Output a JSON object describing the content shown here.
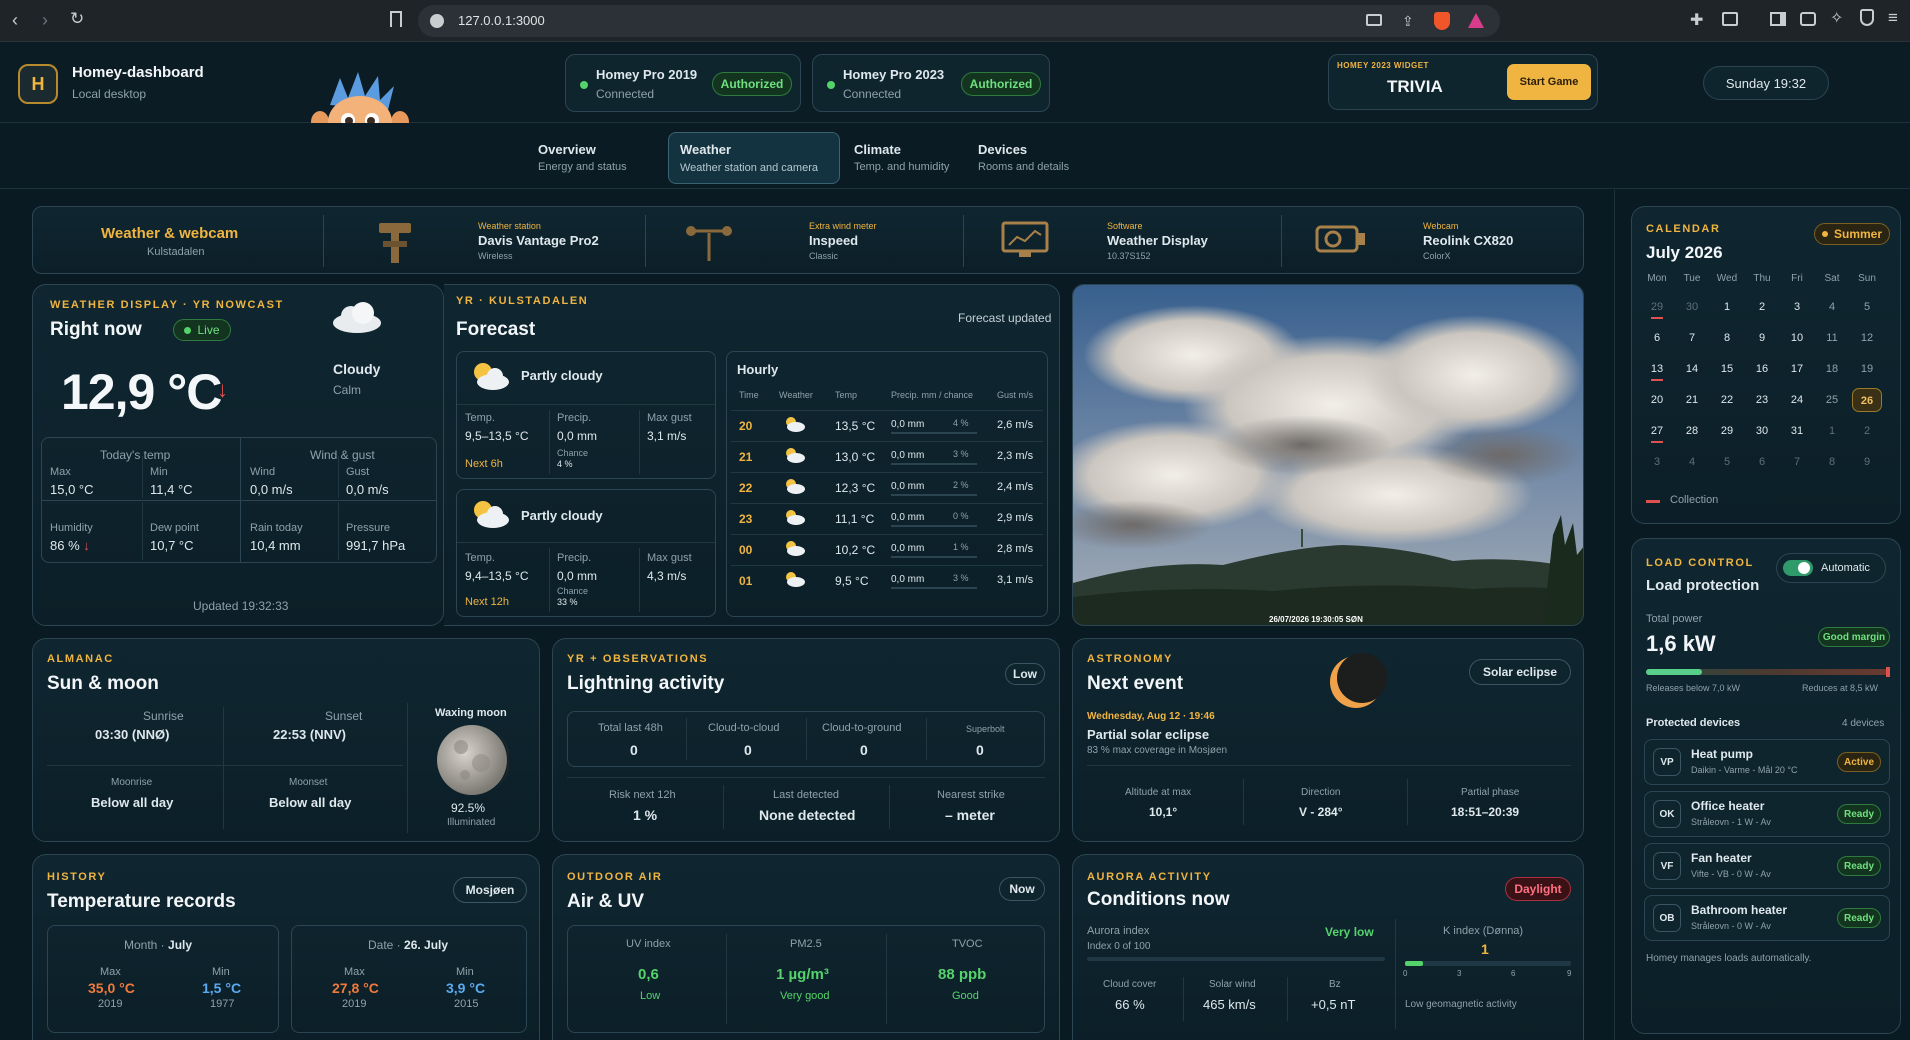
{
  "browser": {
    "url": "127.0.0.1:3000"
  },
  "header": {
    "logo_letter": "H",
    "app_title": "Homey-dashboard",
    "app_subtitle": "Local desktop",
    "devices": [
      {
        "name": "Homey Pro 2019",
        "status": "Connected",
        "badge": "Authorized"
      },
      {
        "name": "Homey Pro 2023",
        "status": "Connected",
        "badge": "Authorized"
      }
    ],
    "widget": {
      "tag": "HOMEY 2023 WIDGET",
      "title": "TRIVIA",
      "button": "Start Game"
    },
    "clock": "Sunday 19:32"
  },
  "tabs": [
    {
      "label": "Overview",
      "sub": "Energy and status"
    },
    {
      "label": "Weather",
      "sub": "Weather station and camera"
    },
    {
      "label": "Climate",
      "sub": "Temp. and humidity"
    },
    {
      "label": "Devices",
      "sub": "Rooms and details"
    }
  ],
  "equip": {
    "title": "Weather & webcam",
    "subtitle": "Kulstadalen",
    "items": [
      {
        "cat": "Weather station",
        "name": "Davis Vantage Pro2",
        "sub": "Wireless"
      },
      {
        "cat": "Extra wind meter",
        "name": "Inspeed",
        "sub": "Classic"
      },
      {
        "cat": "Software",
        "name": "Weather Display",
        "sub": "10.37S152"
      },
      {
        "cat": "Webcam",
        "name": "Reolink CX820",
        "sub": "ColorX"
      }
    ]
  },
  "now": {
    "label": "WEATHER DISPLAY · YR NOWCAST",
    "title": "Right now",
    "live": "Live",
    "temp": "12,9 °C",
    "trend": "↓",
    "condition": "Cloudy",
    "wind_desc": "Calm",
    "today_temp": "Today's temp",
    "wind_gust": "Wind & gust",
    "max_l": "Max",
    "max_v": "15,0 °C",
    "min_l": "Min",
    "min_v": "11,4 °C",
    "wind_l": "Wind",
    "wind_v": "0,0 m/s",
    "gust_l": "Gust",
    "gust_v": "0,0 m/s",
    "hum_l": "Humidity",
    "hum_v": "86 %",
    "dew_l": "Dew point",
    "dew_v": "10,7 °C",
    "rain_l": "Rain today",
    "rain_v": "10,4 mm",
    "pres_l": "Pressure",
    "pres_v": "991,7 hPa",
    "updated": "Updated 19:32:33"
  },
  "forecast": {
    "label": "YR · KULSTADALEN",
    "title": "Forecast",
    "updated": "Forecast updated",
    "blocks": [
      {
        "cond": "Partly cloudy",
        "temp_l": "Temp.",
        "temp_v": "9,5–13,5 °C",
        "precip_l": "Precip.",
        "precip_v": "0,0 mm",
        "chance_l": "Chance",
        "chance_v": "4 %",
        "gust_l": "Max gust",
        "gust_v": "3,1 m/s",
        "period": "Next 6h"
      },
      {
        "cond": "Partly cloudy",
        "temp_l": "Temp.",
        "temp_v": "9,4–13,5 °C",
        "precip_l": "Precip.",
        "precip_v": "0,0 mm",
        "chance_l": "Chance",
        "chance_v": "33 %",
        "gust_l": "Max gust",
        "gust_v": "4,3 m/s",
        "period": "Next 12h"
      }
    ],
    "hourly_title": "Hourly",
    "hourly_cols": [
      "Time",
      "Weather",
      "Temp",
      "Precip. mm / chance",
      "Gust m/s"
    ],
    "hourly": [
      {
        "time": "20",
        "temp": "13,5 °C",
        "precip": "0,0 mm",
        "chance": "4 %",
        "gust": "2,6 m/s"
      },
      {
        "time": "21",
        "temp": "13,0 °C",
        "precip": "0,0 mm",
        "chance": "3 %",
        "gust": "2,3 m/s"
      },
      {
        "time": "22",
        "temp": "12,3 °C",
        "precip": "0,0 mm",
        "chance": "2 %",
        "gust": "2,4 m/s"
      },
      {
        "time": "23",
        "temp": "11,1 °C",
        "precip": "0,0 mm",
        "chance": "0 %",
        "gust": "2,9 m/s"
      },
      {
        "time": "00",
        "temp": "10,2 °C",
        "precip": "0,0 mm",
        "chance": "1 %",
        "gust": "2,8 m/s"
      },
      {
        "time": "01",
        "temp": "9,5 °C",
        "precip": "0,0 mm",
        "chance": "3 %",
        "gust": "3,1 m/s"
      }
    ]
  },
  "webcam": {
    "timestamp": "26/07/2026 19:30:05 SØN"
  },
  "calendar": {
    "label": "CALENDAR",
    "season": "Summer",
    "month": "July 2026",
    "weekdays": [
      "Mon",
      "Tue",
      "Wed",
      "Thu",
      "Fri",
      "Sat",
      "Sun"
    ],
    "weeks": [
      [
        "29",
        "30",
        "1",
        "2",
        "3",
        "4",
        "5"
      ],
      [
        "6",
        "7",
        "8",
        "9",
        "10",
        "11",
        "12"
      ],
      [
        "13",
        "14",
        "15",
        "16",
        "17",
        "18",
        "19"
      ],
      [
        "20",
        "21",
        "22",
        "23",
        "24",
        "25",
        "26"
      ],
      [
        "27",
        "28",
        "29",
        "30",
        "31",
        "1",
        "2"
      ],
      [
        "3",
        "4",
        "5",
        "6",
        "7",
        "8",
        "9"
      ]
    ],
    "legend": "Collection"
  },
  "load": {
    "label": "LOAD CONTROL",
    "title": "Load protection",
    "toggle": "Automatic",
    "total_l": "Total power",
    "total_v": "1,6 kW",
    "margin": "Good margin",
    "power_fraction": 0.23,
    "release": "Releases below 7,0 kW",
    "reduce": "Reduces at 8,5 kW",
    "protected": "Protected devices",
    "count": "4 devices",
    "devices": [
      {
        "initials": "VP",
        "name": "Heat pump",
        "sub": "Daikin - Varme - Mål 20 °C",
        "state": "Active"
      },
      {
        "initials": "OK",
        "name": "Office heater",
        "sub": "Stråleovn - 1 W - Av",
        "state": "Ready"
      },
      {
        "initials": "VF",
        "name": "Fan heater",
        "sub": "Vifte - VB - 0 W - Av",
        "state": "Ready"
      },
      {
        "initials": "OB",
        "name": "Bathroom heater",
        "sub": "Stråleovn - 0 W - Av",
        "state": "Ready"
      }
    ],
    "footer": "Homey manages loads automatically."
  },
  "almanac": {
    "label": "ALMANAC",
    "title": "Sun & moon",
    "sunrise_l": "Sunrise",
    "sunrise_v": "03:30 (NNØ)",
    "sunset_l": "Sunset",
    "sunset_v": "22:53 (NNV)",
    "moonrise_l": "Moonrise",
    "moonrise_v": "Below all day",
    "moonset_l": "Moonset",
    "moonset_v": "Below all day",
    "phase": "Waxing moon",
    "illum_v": "92.5%",
    "illum_l": "Illuminated"
  },
  "lightning": {
    "label": "YR + OBSERVATIONS",
    "title": "Lightning activity",
    "level": "Low",
    "cols": [
      {
        "l": "Total last 48h",
        "v": "0"
      },
      {
        "l": "Cloud-to-cloud",
        "v": "0"
      },
      {
        "l": "Cloud-to-ground",
        "v": "0"
      },
      {
        "l": "Superbolt",
        "v": "0"
      }
    ],
    "risk_l": "Risk next 12h",
    "risk_v": "1 %",
    "last_l": "Last detected",
    "last_v": "None detected",
    "near_l": "Nearest strike",
    "near_v": "– meter"
  },
  "astronomy": {
    "label": "ASTRONOMY",
    "title": "Next event",
    "badge": "Solar eclipse",
    "date": "Wednesday, Aug 12 · 19:46",
    "event": "Partial solar eclipse",
    "coverage": "83 % max coverage in Mosjøen",
    "alt_l": "Altitude at max",
    "alt_v": "10,1°",
    "dir_l": "Direction",
    "dir_v": "V - 284°",
    "phase_l": "Partial phase",
    "phase_v": "18:51–20:39"
  },
  "history": {
    "label": "HISTORY",
    "title": "Temperature records",
    "location": "Mosjøen",
    "month_l": "Month · ",
    "month_v": "July",
    "date_l": "Date · ",
    "date_v": "26. July",
    "m_max_l": "Max",
    "m_max_v": "35,0 °C",
    "m_max_y": "2019",
    "m_min_l": "Min",
    "m_min_v": "1,5 °C",
    "m_min_y": "1977",
    "d_max_l": "Max",
    "d_max_v": "27,8 °C",
    "d_max_y": "2019",
    "d_min_l": "Min",
    "d_min_v": "3,9 °C",
    "d_min_y": "2015"
  },
  "air": {
    "label": "OUTDOOR AIR",
    "title": "Air & UV",
    "badge": "Now",
    "uv_l": "UV index",
    "uv_v": "0,6",
    "uv_s": "Low",
    "pm_l": "PM2.5",
    "pm_v": "1 µg/m³",
    "pm_s": "Very good",
    "tvoc_l": "TVOC",
    "tvoc_v": "88 ppb",
    "tvoc_s": "Good"
  },
  "aurora": {
    "label": "AURORA ACTIVITY",
    "title": "Conditions now",
    "badge": "Daylight",
    "index_l": "Aurora index",
    "index_sub": "Index 0 of 100",
    "index_v": "Very low",
    "k_l": "K index (Dønna)",
    "k_v": "1",
    "k_ticks": [
      "0",
      "3",
      "6",
      "9"
    ],
    "kp_fraction": 0.11,
    "cloud_l": "Cloud cover",
    "cloud_v": "66 %",
    "wind_l": "Solar wind",
    "wind_v": "465 km/s",
    "bz_l": "Bz",
    "bz_v": "+0,5 nT",
    "geo": "Low geomagnetic activity"
  },
  "colors": {
    "accent": "#f0b441",
    "good": "#55d36b",
    "danger": "#e05050",
    "bg": "#0a1a22"
  }
}
